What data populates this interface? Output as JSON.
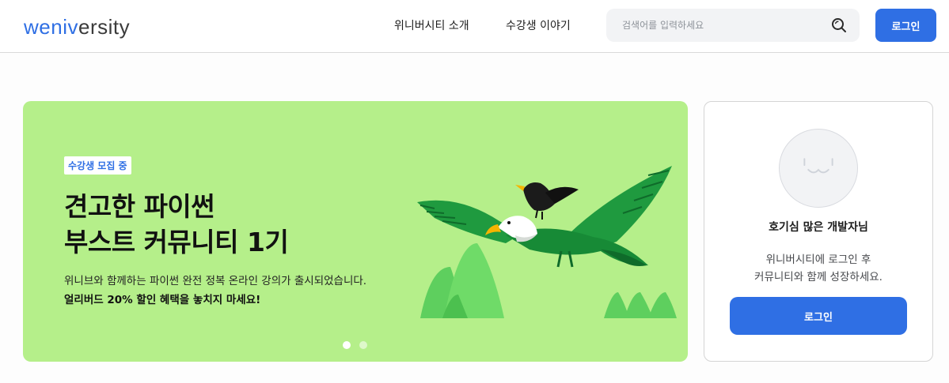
{
  "header": {
    "logo": {
      "accent": "weniv",
      "rest": "ersity"
    },
    "nav": [
      {
        "label": "위니버시티 소개"
      },
      {
        "label": "수강생 이야기"
      }
    ],
    "search": {
      "placeholder": "검색어를 입력하세요",
      "value": "",
      "icon": "search-icon"
    },
    "login_label": "로그인"
  },
  "banner": {
    "badge": "수강생 모집 중",
    "headline_line1": "견고한 파이썬",
    "headline_line2": "부스트 커뮤니티 1기",
    "description": "위니브와 함께하는 파이썬 완전 정복 온라인 강의가 출시되었습니다.",
    "description_bold": "얼리버드 20% 할인 혜택을 놓치지 마세요!",
    "background_color": "#b5ef8a",
    "slides": {
      "count": 2,
      "active_index": 0
    }
  },
  "login_card": {
    "title": "호기심 많은 개발자님",
    "desc_line1": "위니버시티에 로그인 후",
    "desc_line2": "커뮤니티와 함께 성장하세요.",
    "login_label": "로그인",
    "avatar_icon": "smiley-avatar-icon"
  },
  "colors": {
    "accent": "#2f6fe4",
    "banner_green": "#b5ef8a",
    "eagle_green": "#1f9a3f",
    "hill_green": "#5ecf5e"
  }
}
